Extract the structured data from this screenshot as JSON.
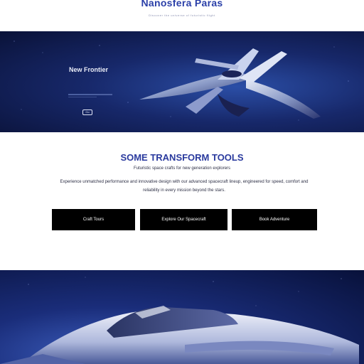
{
  "header": {
    "brand": "Nanosfera Paras",
    "tagline": "Discover the universe of futuristic flight"
  },
  "hero": {
    "title": "New Frontier",
    "cta_label": "Go"
  },
  "services": {
    "title": "SOME TRANSFORM TOOLS",
    "subtitle": "Futuristic space crafts for new generation explorers",
    "description": "Experience unmatched performance and innovative design with our advanced spacecraft lineup, engineered for speed, comfort and reliability in every mission beyond the stars.",
    "buttons": [
      "Craft Tours",
      "Explore Our Spacecraft",
      "Book Adventure"
    ]
  },
  "colors": {
    "brand": "#2a3fa8",
    "hero_bg": "#17286a",
    "button_bg": "#000000"
  }
}
